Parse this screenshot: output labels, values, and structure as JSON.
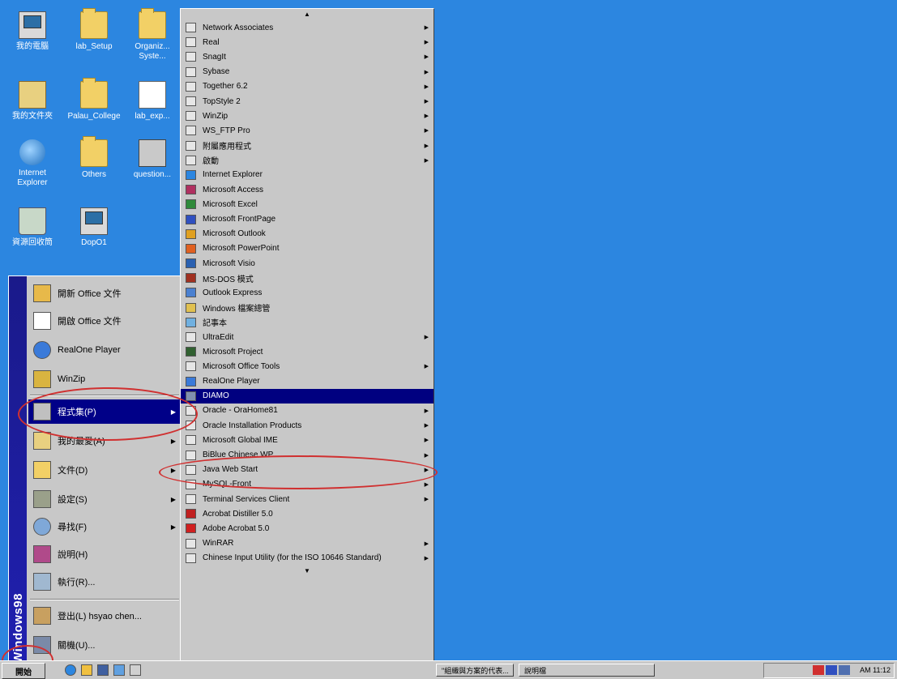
{
  "desktop": {
    "icons": [
      {
        "label": "我的電腦",
        "icon": "computer-icon"
      },
      {
        "label": "lab_Setup",
        "icon": "folder-icon"
      },
      {
        "label": "Organiz... Syste...",
        "icon": "folder-icon"
      },
      {
        "label": "我的文件夾",
        "icon": "my-documents-icon"
      },
      {
        "label": "Palau_College",
        "icon": "folder-icon"
      },
      {
        "label": "lab_exp...",
        "icon": "document-icon"
      },
      {
        "label": "Internet Explorer",
        "icon": "ie-icon"
      },
      {
        "label": "Others",
        "icon": "folder-icon"
      },
      {
        "label": "question...",
        "icon": "app-icon"
      },
      {
        "label": "資源回收筒",
        "icon": "recycle-bin-icon"
      },
      {
        "label": "DopO1",
        "icon": "computer-icon"
      }
    ]
  },
  "start_menu": {
    "banner": "Windows98",
    "items": [
      {
        "label": "開新 Office 文件",
        "has_submenu": false
      },
      {
        "label": "開啟 Office 文件",
        "has_submenu": false
      },
      {
        "label": "RealOne Player",
        "has_submenu": false
      },
      {
        "label": "WinZip",
        "has_submenu": false
      },
      {
        "label": "程式集(P)",
        "has_submenu": true,
        "selected": true
      },
      {
        "label": "我的最愛(A)",
        "has_submenu": true
      },
      {
        "label": "文件(D)",
        "has_submenu": true
      },
      {
        "label": "設定(S)",
        "has_submenu": true
      },
      {
        "label": "尋找(F)",
        "has_submenu": true
      },
      {
        "label": "說明(H)",
        "has_submenu": false
      },
      {
        "label": "執行(R)...",
        "has_submenu": false
      },
      {
        "label": "登出(L) hsyao chen...",
        "has_submenu": false
      },
      {
        "label": "關機(U)...",
        "has_submenu": false
      }
    ]
  },
  "programs_submenu": {
    "items": [
      {
        "label": "Network Associates",
        "has_submenu": true,
        "icon": "program-group-icon"
      },
      {
        "label": "Real",
        "has_submenu": true,
        "icon": "program-group-icon"
      },
      {
        "label": "SnagIt",
        "has_submenu": true,
        "icon": "program-group-icon"
      },
      {
        "label": "Sybase",
        "has_submenu": true,
        "icon": "program-group-icon"
      },
      {
        "label": "Together 6.2",
        "has_submenu": true,
        "icon": "program-group-icon"
      },
      {
        "label": "TopStyle 2",
        "has_submenu": true,
        "icon": "program-group-icon"
      },
      {
        "label": "WinZip",
        "has_submenu": true,
        "icon": "program-group-icon"
      },
      {
        "label": "WS_FTP Pro",
        "has_submenu": true,
        "icon": "program-group-icon"
      },
      {
        "label": "附屬應用程式",
        "has_submenu": true,
        "icon": "program-group-icon"
      },
      {
        "label": "啟動",
        "has_submenu": true,
        "icon": "program-group-icon"
      },
      {
        "label": "Internet Explorer",
        "has_submenu": false,
        "icon": "ie-icon"
      },
      {
        "label": "Microsoft Access",
        "has_submenu": false,
        "icon": "access-icon"
      },
      {
        "label": "Microsoft Excel",
        "has_submenu": false,
        "icon": "excel-icon"
      },
      {
        "label": "Microsoft FrontPage",
        "has_submenu": false,
        "icon": "frontpage-icon"
      },
      {
        "label": "Microsoft Outlook",
        "has_submenu": false,
        "icon": "outlook-icon"
      },
      {
        "label": "Microsoft PowerPoint",
        "has_submenu": false,
        "icon": "powerpoint-icon"
      },
      {
        "label": "Microsoft Visio",
        "has_submenu": false,
        "icon": "visio-icon"
      },
      {
        "label": "MS-DOS 模式",
        "has_submenu": false,
        "icon": "msdos-icon"
      },
      {
        "label": "Outlook Express",
        "has_submenu": false,
        "icon": "outlook-express-icon"
      },
      {
        "label": "Windows 檔案總管",
        "has_submenu": false,
        "icon": "explorer-icon"
      },
      {
        "label": "記事本",
        "has_submenu": false,
        "icon": "notepad-icon"
      },
      {
        "label": "UltraEdit",
        "has_submenu": true,
        "icon": "program-group-icon"
      },
      {
        "label": "Microsoft Project",
        "has_submenu": false,
        "icon": "project-icon"
      },
      {
        "label": "Microsoft Office Tools",
        "has_submenu": true,
        "icon": "program-group-icon"
      },
      {
        "label": "RealOne Player",
        "has_submenu": false,
        "icon": "realone-icon"
      },
      {
        "label": "DIAMO",
        "has_submenu": false,
        "icon": "diamo-icon",
        "selected": true
      },
      {
        "label": "Oracle - OraHome81",
        "has_submenu": true,
        "icon": "program-group-icon"
      },
      {
        "label": "Oracle Installation Products",
        "has_submenu": true,
        "icon": "program-group-icon"
      },
      {
        "label": "Microsoft Global IME",
        "has_submenu": true,
        "icon": "program-group-icon"
      },
      {
        "label": "BiBlue Chinese WP",
        "has_submenu": true,
        "icon": "program-group-icon"
      },
      {
        "label": "Java Web Start",
        "has_submenu": true,
        "icon": "program-group-icon"
      },
      {
        "label": "MySQL-Front",
        "has_submenu": true,
        "icon": "program-group-icon"
      },
      {
        "label": "Terminal Services Client",
        "has_submenu": true,
        "icon": "program-group-icon"
      },
      {
        "label": "Acrobat Distiller 5.0",
        "has_submenu": false,
        "icon": "distiller-icon"
      },
      {
        "label": "Adobe Acrobat 5.0",
        "has_submenu": false,
        "icon": "acrobat-icon"
      },
      {
        "label": "WinRAR",
        "has_submenu": true,
        "icon": "program-group-icon"
      },
      {
        "label": "Chinese Input Utility (for the ISO 10646 Standard)",
        "has_submenu": true,
        "icon": "program-group-icon"
      }
    ]
  },
  "taskbar": {
    "start_label": "開始",
    "tasks": [
      "\"組織與方案的代表...",
      "說明檔"
    ],
    "clock": "AM 11:12"
  },
  "colors": {
    "desktop": "#2c86e0",
    "menu_face": "#c8c8c8",
    "selection": "#000080",
    "annotation": "#d03030"
  }
}
